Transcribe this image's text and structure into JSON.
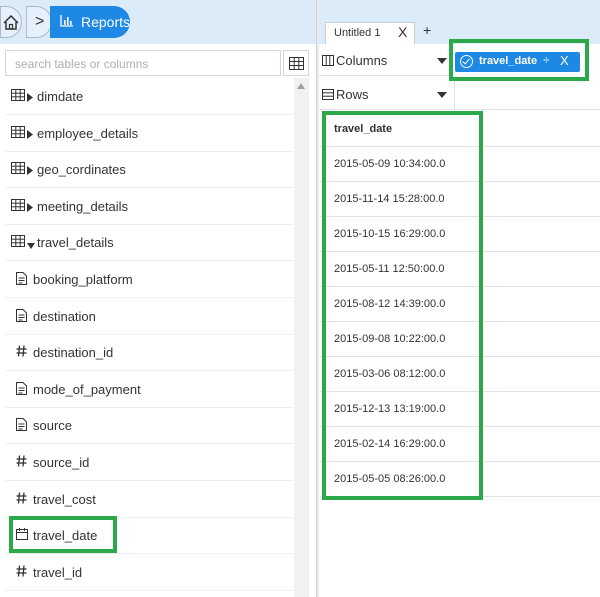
{
  "header": {
    "reports_label": "Reports",
    "breadcrumb_separator": ">"
  },
  "tabs": {
    "active_label": "Untitled 1",
    "close_glyph": "X",
    "add_glyph": "+"
  },
  "sidebar": {
    "search_placeholder": "search tables or columns",
    "items": [
      {
        "label": "dimdate",
        "icon": "table-icon",
        "expandable": true,
        "expanded": false
      },
      {
        "label": "employee_details",
        "icon": "table-icon",
        "expandable": true,
        "expanded": false
      },
      {
        "label": "geo_cordinates",
        "icon": "table-icon",
        "expandable": true,
        "expanded": false
      },
      {
        "label": "meeting_details",
        "icon": "table-icon",
        "expandable": true,
        "expanded": false
      },
      {
        "label": "travel_details",
        "icon": "table-icon",
        "expandable": true,
        "expanded": true
      },
      {
        "label": "booking_platform",
        "icon": "text-field-icon"
      },
      {
        "label": "destination",
        "icon": "text-field-icon"
      },
      {
        "label": "destination_id",
        "icon": "numeric-field-icon"
      },
      {
        "label": "mode_of_payment",
        "icon": "text-field-icon"
      },
      {
        "label": "source",
        "icon": "text-field-icon"
      },
      {
        "label": "source_id",
        "icon": "numeric-field-icon"
      },
      {
        "label": "travel_cost",
        "icon": "numeric-field-icon"
      },
      {
        "label": "travel_date",
        "icon": "calendar-icon"
      },
      {
        "label": "travel_id",
        "icon": "numeric-field-icon"
      }
    ]
  },
  "drop_zones": {
    "columns_label": "Columns",
    "rows_label": "Rows",
    "column_pill": {
      "label": "travel_date",
      "sort_glyph": "÷",
      "remove_glyph": "X"
    }
  },
  "table": {
    "header": "travel_date",
    "rows": [
      "2015-05-09 10:34:00.0",
      "2015-11-14 15:28:00.0",
      "2015-10-15 16:29:00.0",
      "2015-05-11 12:50:00.0",
      "2015-08-12 14:39:00.0",
      "2015-09-08 10:22:00.0",
      "2015-03-06 08:12:00.0",
      "2015-12-13 13:19:00.0",
      "2015-02-14 16:29:00.0",
      "2015-05-05 08:26:00.0"
    ]
  },
  "colors": {
    "accent": "#1e88e5",
    "highlight": "#2aa84a",
    "topbar_bg": "#dcebf8"
  }
}
